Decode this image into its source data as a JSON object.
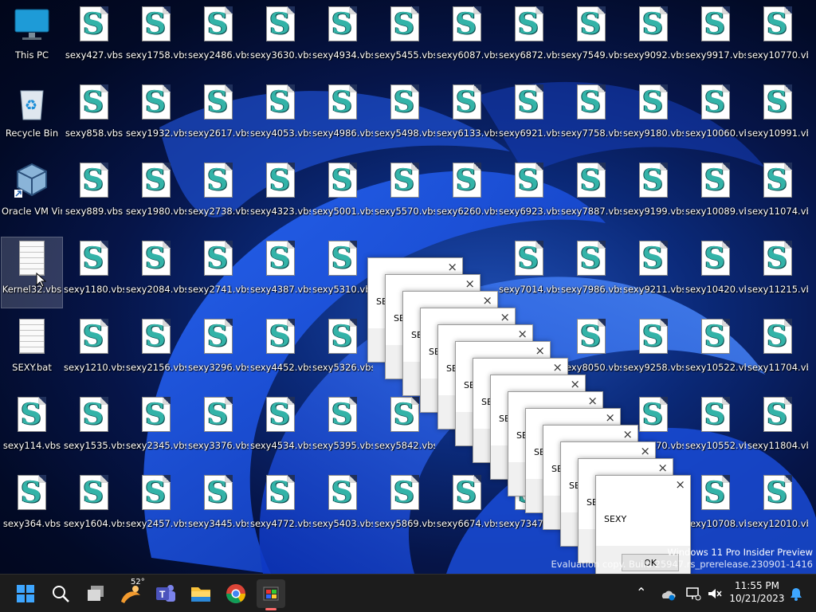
{
  "desktop": {
    "system_icons": [
      {
        "label": "This PC",
        "icon": "monitor-icon"
      },
      {
        "label": "Recycle Bin",
        "icon": "recycle-bin-icon"
      },
      {
        "label": "Oracle VM VirtualBox",
        "icon": "virtualbox-icon"
      },
      {
        "label": "Kernel32.vbs",
        "icon": "text-file-icon"
      },
      {
        "label": "SEXY.bat",
        "icon": "text-file-icon"
      },
      {
        "label": "sexy114.vbs",
        "icon": "vbs-script-icon"
      },
      {
        "label": "sexy364.vbs",
        "icon": "vbs-script-icon"
      }
    ],
    "vbs_grid": [
      [
        "sexy427.vbs",
        "sexy1758.vbs",
        "sexy2486.vbs",
        "sexy3630.vbs",
        "sexy4934.vbs",
        "sexy5455.vbs",
        "sexy6087.vbs",
        "sexy6872.vbs",
        "sexy7549.vbs",
        "sexy9092.vbs",
        "sexy9917.vbs",
        "sexy10770.vbs"
      ],
      [
        "sexy858.vbs",
        "sexy1932.vbs",
        "sexy2617.vbs",
        "sexy4053.vbs",
        "sexy4986.vbs",
        "sexy5498.vbs",
        "sexy6133.vbs",
        "sexy6921.vbs",
        "sexy7758.vbs",
        "sexy9180.vbs",
        "sexy10060.vbs",
        "sexy10991.vbs"
      ],
      [
        "sexy889.vbs",
        "sexy1980.vbs",
        "sexy2738.vbs",
        "sexy4323.vbs",
        "sexy5001.vbs",
        "sexy5570.vbs",
        "sexy6260.vbs",
        "sexy6923.vbs",
        "sexy7887.vbs",
        "sexy9199.vbs",
        "sexy10089.vbs",
        "sexy11074.vbs"
      ],
      [
        "sexy1180.vbs",
        "sexy2084.vbs",
        "sexy2741.vbs",
        "sexy4387.vbs",
        "sexy5310.vbs",
        "",
        "",
        "sexy7014.vbs",
        "sexy7986.vbs",
        "sexy9211.vbs",
        "sexy10420.vbs",
        "sexy11215.vbs"
      ],
      [
        "sexy1210.vbs",
        "sexy2156.vbs",
        "sexy3296.vbs",
        "sexy4452.vbs",
        "sexy5326.vbs",
        "",
        "",
        "",
        "sexy8050.vbs",
        "sexy9258.vbs",
        "sexy10522.vbs",
        "sexy11704.vbs"
      ],
      [
        "sexy1535.vbs",
        "sexy2345.vbs",
        "sexy3376.vbs",
        "sexy4534.vbs",
        "sexy5395.vbs",
        "sexy5842.vbs",
        "",
        "",
        "",
        "sexy9470.vbs",
        "sexy10552.vbs",
        "sexy11804.vbs"
      ],
      [
        "sexy1604.vbs",
        "sexy2457.vbs",
        "sexy3445.vbs",
        "sexy4772.vbs",
        "sexy5403.vbs",
        "sexy5869.vbs",
        "sexy6674.vbs",
        "sexy7347.vbs",
        "",
        "",
        "sexy10708.vbs",
        "sexy12010.vbs"
      ]
    ]
  },
  "dialogs": {
    "message": "SEXY",
    "ok_label": "OK",
    "close_glyph": "×",
    "count": 14
  },
  "watermark": {
    "line1": "Windows 11 Pro Insider Preview",
    "line2": "Evaluation copy. Build 25947.rs_prerelease.230901-1416"
  },
  "taskbar": {
    "weather_temp": "52°",
    "apps": [
      "start-icon",
      "search-icon",
      "task-view-icon",
      "weather-icon",
      "teams-icon",
      "file-explorer-icon",
      "chrome-icon",
      "app-icon"
    ],
    "clock_time": "11:55 PM",
    "clock_date": "10/21/2023",
    "tray_chevron": "⌃"
  },
  "colors": {
    "taskbar": "#1c1c1c",
    "accent": "#0078d4",
    "script_teal": "#33b3a8"
  }
}
